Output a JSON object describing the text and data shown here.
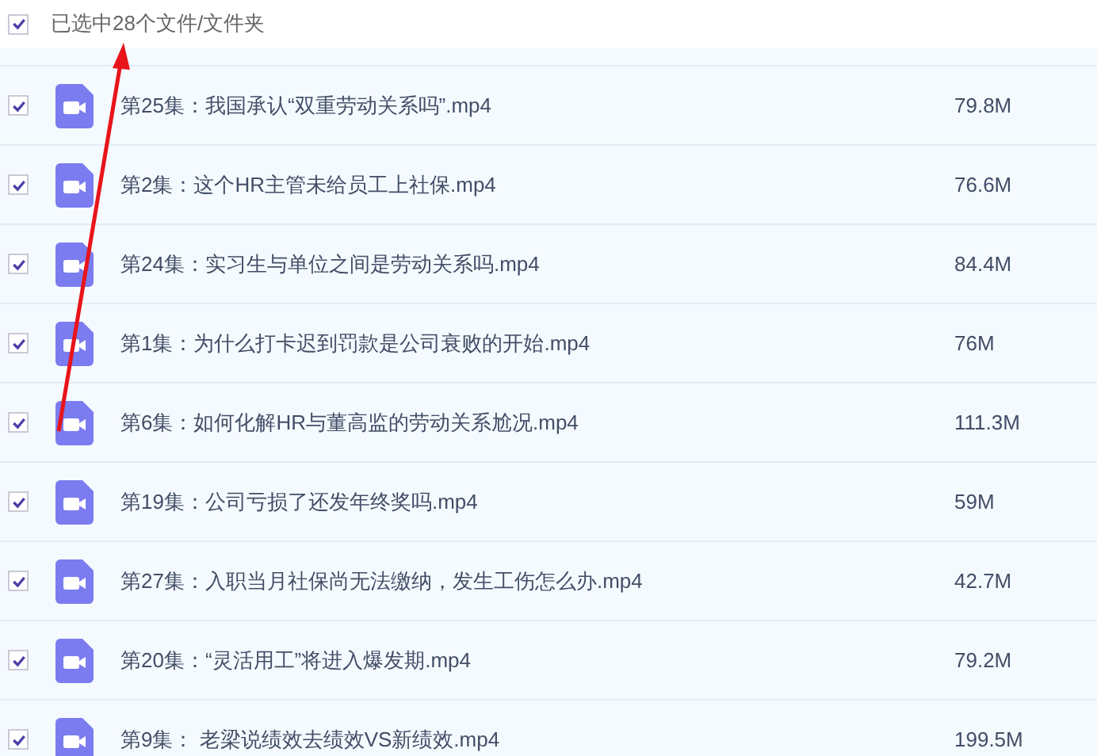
{
  "header": {
    "checked": true,
    "label": "已选中28个文件/文件夹"
  },
  "files": [
    {
      "checked": true,
      "name": "第25集：我国承认“双重劳动关系吗”.mp4",
      "size": "79.8M"
    },
    {
      "checked": true,
      "name": "第2集：这个HR主管未给员工上社保.mp4",
      "size": "76.6M"
    },
    {
      "checked": true,
      "name": "第24集：实习生与单位之间是劳动关系吗.mp4",
      "size": "84.4M"
    },
    {
      "checked": true,
      "name": "第1集：为什么打卡迟到罚款是公司衰败的开始.mp4",
      "size": "76M"
    },
    {
      "checked": true,
      "name": "第6集：如何化解HR与董高监的劳动关系尬况.mp4",
      "size": "111.3M"
    },
    {
      "checked": true,
      "name": "第19集：公司亏损了还发年终奖吗.mp4",
      "size": "59M"
    },
    {
      "checked": true,
      "name": "第27集：入职当月社保尚无法缴纳，发生工伤怎么办.mp4",
      "size": "42.7M"
    },
    {
      "checked": true,
      "name": "第20集：“灵活用工”将进入爆发期.mp4",
      "size": "79.2M"
    },
    {
      "checked": true,
      "name": "第9集： 老梁说绩效去绩效VS新绩效.mp4",
      "size": "199.5M"
    }
  ]
}
